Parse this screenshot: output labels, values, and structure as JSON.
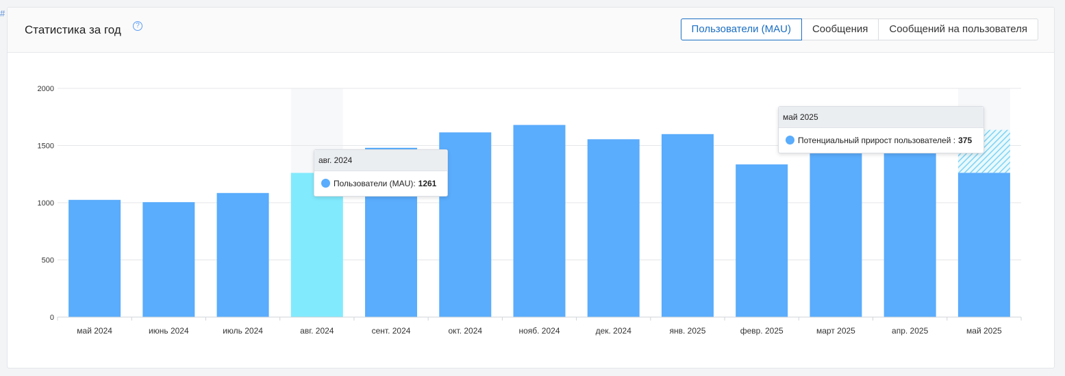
{
  "page": {
    "corner_mark": "#"
  },
  "header": {
    "title": "Статистика за год",
    "help_icon": "?",
    "tabs": [
      {
        "label": "Пользователи (MAU)",
        "active": true
      },
      {
        "label": "Сообщения",
        "active": false
      },
      {
        "label": "Сообщений на пользователя",
        "active": false
      }
    ]
  },
  "colors": {
    "bar": "#5aacfc",
    "bar_highlight": "#82eafd",
    "potential": "#7ed3f5",
    "hover_band": "#f7f8fa",
    "accent": "#1b6ec2"
  },
  "chart_data": {
    "type": "bar",
    "categories": [
      "май 2024",
      "июнь 2024",
      "июль 2024",
      "авг. 2024",
      "сент. 2024",
      "окт. 2024",
      "нояб. 2024",
      "дек. 2024",
      "янв. 2025",
      "февр. 2025",
      "март 2025",
      "апр. 2025",
      "май 2025"
    ],
    "series": [
      {
        "name": "Пользователи (MAU)",
        "values": [
          1025,
          1005,
          1085,
          1261,
          1480,
          1615,
          1680,
          1555,
          1600,
          1335,
          1490,
          1495,
          1262
        ]
      },
      {
        "name": "Потенциальный прирост пользователей",
        "values": [
          0,
          0,
          0,
          0,
          0,
          0,
          0,
          0,
          0,
          0,
          0,
          0,
          375
        ]
      }
    ],
    "ylim": [
      0,
      2000
    ],
    "yticks": [
      0,
      500,
      1000,
      1500,
      2000
    ],
    "grid": true,
    "highlighted_index": 3,
    "hover_bands": [
      3,
      12
    ]
  },
  "tooltips": [
    {
      "title": "авг. 2024",
      "label": "Пользователи (MAU):",
      "value": "1261"
    },
    {
      "title": "май 2025",
      "label": "Потенциальный прирост пользователей :",
      "value": "375"
    }
  ]
}
